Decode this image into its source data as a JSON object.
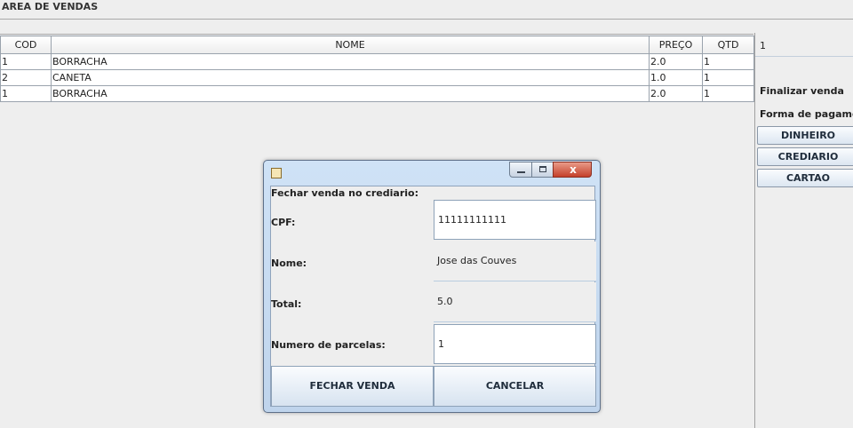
{
  "window": {
    "title": "AREA DE VENDAS"
  },
  "table": {
    "columns": [
      "COD",
      "NOME",
      "PREÇO",
      "QTD"
    ],
    "rows": [
      [
        "1",
        "BORRACHA",
        "2.0",
        "1"
      ],
      [
        "2",
        "CANETA",
        "1.0",
        "1"
      ],
      [
        "1",
        "BORRACHA",
        "2.0",
        "1"
      ]
    ]
  },
  "sidebar": {
    "quantity_value": "1",
    "finalize_label": "Finalizar venda",
    "payment_label": "Forma de pagamento",
    "buttons": [
      "DINHEIRO",
      "CREDIARIO",
      "CARTAO"
    ]
  },
  "dialog": {
    "heading": "Fechar venda no crediario:",
    "cpf_label": "CPF:",
    "cpf_value": "11111111111",
    "name_label": "Nome:",
    "name_value": "Jose das Couves",
    "total_label": "Total:",
    "total_value": "5.0",
    "installments_label": "Numero de parcelas:",
    "installments_value": "1",
    "confirm_button": "FECHAR VENDA",
    "cancel_button": "CANCELAR",
    "close_glyph": "x"
  }
}
